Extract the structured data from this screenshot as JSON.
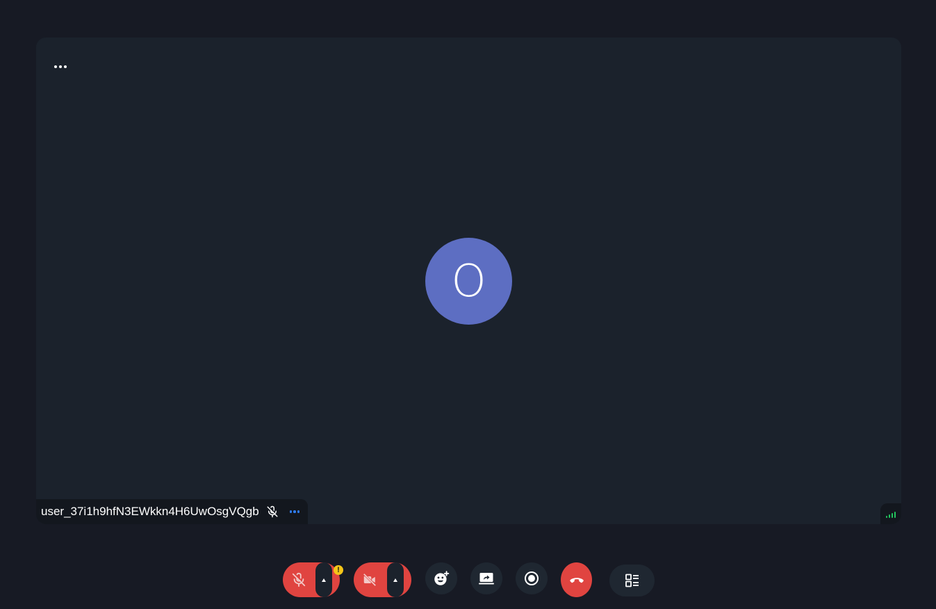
{
  "participant": {
    "initial": "O",
    "name": "user_37i1h9hfN3EWkkn4H6UwOsgVQgb",
    "muted": true,
    "signal_bars": 4
  },
  "toolbar": {
    "mic": {
      "icon": "mic-off-icon",
      "state": "muted",
      "warning": "!"
    },
    "camera": {
      "icon": "video-off-icon",
      "state": "off"
    },
    "reactions": {
      "icon": "add-reaction-icon"
    },
    "screenshare": {
      "icon": "screen-share-icon"
    },
    "record": {
      "icon": "record-icon"
    },
    "leave": {
      "icon": "hang-up-icon"
    },
    "layout": {
      "icon": "layout-list-icon"
    }
  },
  "colors": {
    "background": "#171a24",
    "stage": "#1b222c",
    "avatar": "#5d6ec2",
    "danger": "#e04440",
    "warning": "#f5c518",
    "signal": "#22c55e",
    "accent_dots": "#2f7df6"
  }
}
